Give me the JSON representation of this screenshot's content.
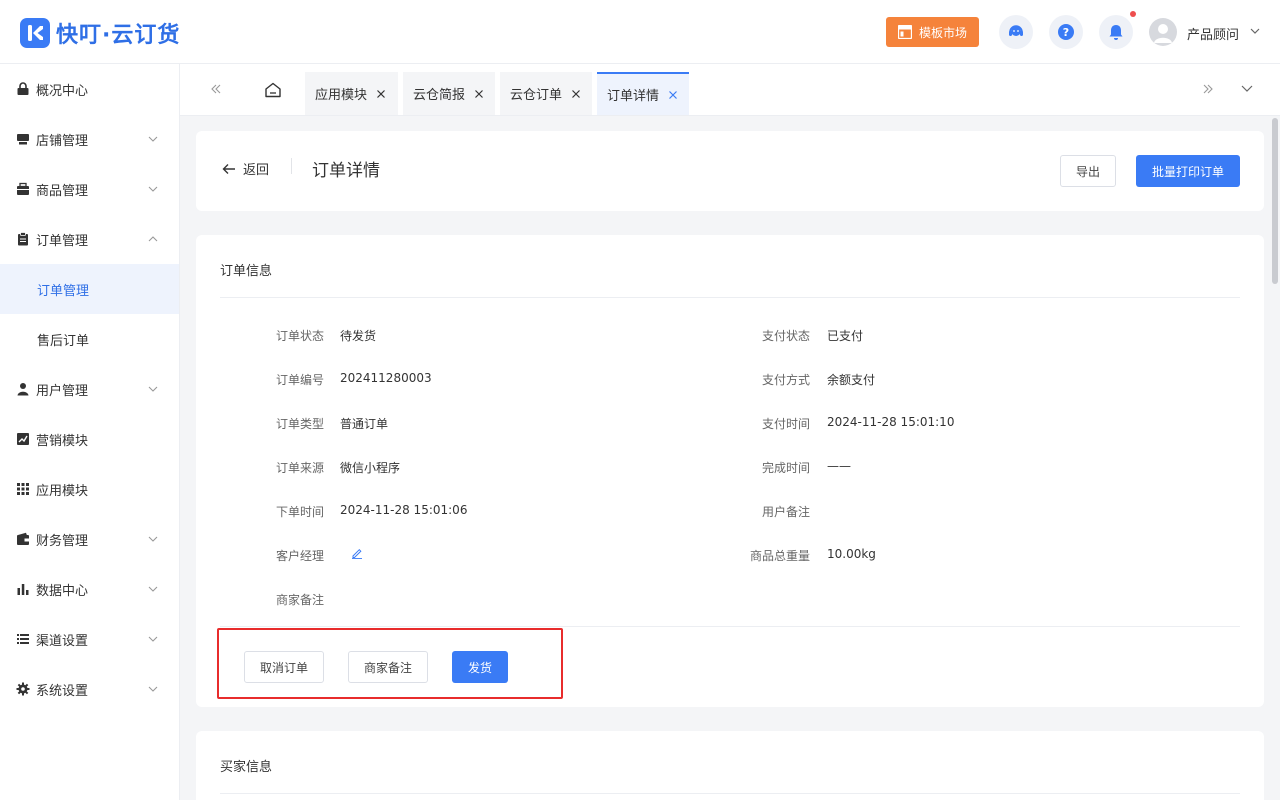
{
  "app": {
    "name": "快叮·云订货"
  },
  "header": {
    "template_market": "模板市场",
    "user_name": "产品顾问"
  },
  "sidebar": {
    "items": [
      {
        "label": "概况中心"
      },
      {
        "label": "店铺管理"
      },
      {
        "label": "商品管理"
      },
      {
        "label": "订单管理"
      },
      {
        "label": "订单管理"
      },
      {
        "label": "售后订单"
      },
      {
        "label": "用户管理"
      },
      {
        "label": "营销模块"
      },
      {
        "label": "应用模块"
      },
      {
        "label": "财务管理"
      },
      {
        "label": "数据中心"
      },
      {
        "label": "渠道设置"
      },
      {
        "label": "系统设置"
      }
    ]
  },
  "tabs": [
    {
      "label": "应用模块"
    },
    {
      "label": "云仓简报"
    },
    {
      "label": "云仓订单"
    },
    {
      "label": "订单详情"
    }
  ],
  "page": {
    "back": "返回",
    "title": "订单详情",
    "export": "导出",
    "batch_print": "批量打印订单"
  },
  "order_info": {
    "title": "订单信息",
    "fields": [
      {
        "label": "订单状态",
        "value": "待发货"
      },
      {
        "label": "支付状态",
        "value": "已支付"
      },
      {
        "label": "订单编号",
        "value": "202411280003"
      },
      {
        "label": "支付方式",
        "value": "余额支付"
      },
      {
        "label": "订单类型",
        "value": "普通订单"
      },
      {
        "label": "支付时间",
        "value": "2024-11-28 15:01:10"
      },
      {
        "label": "订单来源",
        "value": "微信小程序"
      },
      {
        "label": "完成时间",
        "value": "——"
      },
      {
        "label": "下单时间",
        "value": "2024-11-28 15:01:06"
      },
      {
        "label": "用户备注",
        "value": ""
      },
      {
        "label": "客户经理",
        "value": ""
      },
      {
        "label": "商品总重量",
        "value": "10.00kg"
      },
      {
        "label": "商家备注",
        "value": ""
      }
    ],
    "actions": {
      "cancel": "取消订单",
      "remark": "商家备注",
      "ship": "发货"
    }
  },
  "buyer_info": {
    "title": "买家信息"
  },
  "colors": {
    "accent": "#3a7bf5",
    "template_btn": "#f5833b",
    "highlight": "#e82c2c"
  }
}
